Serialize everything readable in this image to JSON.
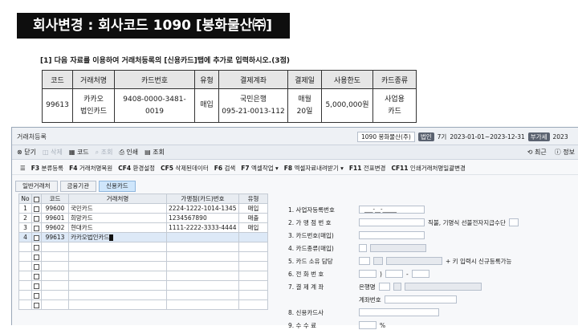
{
  "banner": {
    "title": "회사변경 : 회사코드 1090  [봉화물산㈜]"
  },
  "question": "[1] 다음 자료를 이용하여 거래처등록의 [신용카드]탭에 추가로 입력하시오.(3점)",
  "ref_table": {
    "headers": [
      "코드",
      "거래처명",
      "카드번호",
      "유형",
      "결제계좌",
      "결제일",
      "사용한도",
      "카드종류"
    ],
    "row": {
      "code": "99613",
      "name_1": "카카오",
      "name_2": "법인카드",
      "card_no": "9408-0000-3481-0019",
      "type": "매입",
      "account_1": "국민은행",
      "account_2": "095-21-0013-112",
      "payday_1": "매월",
      "payday_2": "20일",
      "limit": "5,000,000원",
      "kind_1": "사업용",
      "kind_2": "카드"
    }
  },
  "window": {
    "title": "거래처등록",
    "company_code": "1090",
    "company_name": "봉화물산(주)",
    "tag1": "법인",
    "period_no": "7기",
    "period": "2023-01-01~2023-12-31",
    "tag2": "부가세",
    "year": "2023"
  },
  "toolbar": {
    "close": "닫기",
    "delete": "삭제",
    "code": "코드",
    "search": "조회",
    "print": "인쇄",
    "query": "조회",
    "recent": "최근",
    "info": "정보"
  },
  "fnbar": {
    "f3": "F3",
    "f3_label": "분류등록",
    "f4": "F4",
    "f4_label": "거래처명복원",
    "cf4": "CF4",
    "cf4_label": "환경설정",
    "cf5": "CF5",
    "cf5_label": "삭제된데이터",
    "f6": "F6",
    "f6_label": "검색",
    "f7": "F7",
    "f7_label": "엑셀작업",
    "f8": "F8",
    "f8_label": "엑셀자료내려받기",
    "f11": "F11",
    "f11_label": "전표변경",
    "cf11": "CF11",
    "cf11_label": "인쇄거래처명일괄변경"
  },
  "tabs": [
    "일반거래처",
    "금융기관",
    "신용카드"
  ],
  "grid": {
    "headers": [
      "No",
      "",
      "코드",
      "거래처명",
      "가맹점(카드)번호",
      "유형"
    ],
    "rows": [
      {
        "no": "1",
        "code": "99600",
        "name": "국민카드",
        "card": "2224-1222-1014-1345",
        "type": "매입"
      },
      {
        "no": "2",
        "code": "99601",
        "name": "희망카드",
        "card": "1234567890",
        "type": "매출"
      },
      {
        "no": "3",
        "code": "99602",
        "name": "현대카드",
        "card": "1111-2222-3333-4444",
        "type": "매입"
      },
      {
        "no": "4",
        "code": "99613",
        "name": "카카오법인카드",
        "card": "",
        "type": ""
      }
    ]
  },
  "form": {
    "f1": "1. 사업자등록번호",
    "f1_value": "___-__-_____",
    "f2": "2. 가 맹 점 번 호",
    "f2_note": "직불, 기명식 선불전자지급수단",
    "f3": "3. 카드번호(매입)",
    "f4": "4. 카드종류(매입)",
    "f5": "5. 카드 소유 담당",
    "f5_note": "+ 키 입력시 신규등록가능",
    "f6": "6. 전 화 번 호",
    "f6_sep": ")",
    "f6_dash": "-",
    "f7": "7. 결 제 계 좌",
    "bank_label": "은행명",
    "account_label": "계좌번호",
    "f8": "8. 신용카드사",
    "f9": "9. 수   수   료",
    "f9_unit": "%"
  }
}
